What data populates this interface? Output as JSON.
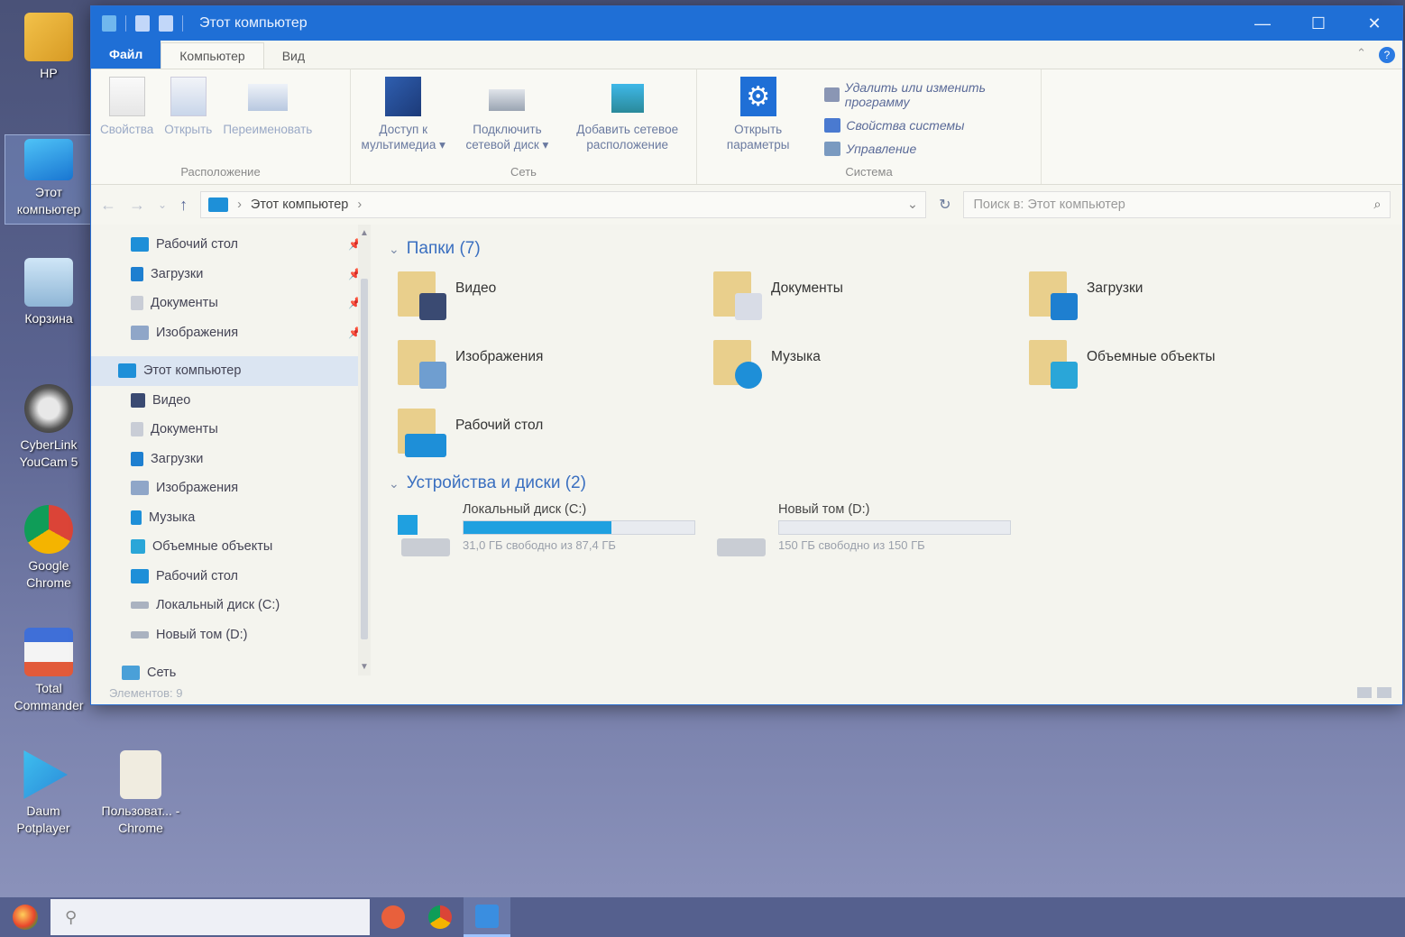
{
  "desktop": {
    "icons": [
      {
        "label": "HP"
      },
      {
        "label": "Этот компьютер"
      },
      {
        "label": "Корзина"
      },
      {
        "label": "CyberLink YouCam 5"
      },
      {
        "label": "Google Chrome"
      },
      {
        "label": "Total Commander"
      },
      {
        "label": "Daum Potplayer"
      },
      {
        "label": "Пользоват... - Chrome"
      }
    ]
  },
  "window": {
    "title": "Этот компьютер",
    "controls": {
      "minimize": "—",
      "maximize": "☐",
      "close": "✕"
    },
    "tabs": [
      {
        "label": "Файл"
      },
      {
        "label": "Компьютер"
      },
      {
        "label": "Вид"
      }
    ],
    "help": "?",
    "ribbon": {
      "location": {
        "label": "Расположение",
        "buttons": [
          {
            "label": "Свойства"
          },
          {
            "label": "Открыть"
          },
          {
            "label": "Переименовать"
          }
        ]
      },
      "network": {
        "label": "Сеть",
        "buttons": [
          {
            "label": "Доступ к мультимедиа ▾"
          },
          {
            "label": "Подключить сетевой диск ▾"
          },
          {
            "label": "Добавить сетевое расположение"
          }
        ]
      },
      "system": {
        "label": "Система",
        "open_settings": "Открыть параметры",
        "items": [
          {
            "label": "Удалить или изменить программу"
          },
          {
            "label": "Свойства системы"
          },
          {
            "label": "Управление"
          }
        ]
      }
    },
    "address": {
      "back": "←",
      "forward": "→",
      "recent": "⌄",
      "up": "↑",
      "path_sep": "›",
      "path": "Этот компьютер",
      "path_end": "›",
      "dropdown": "⌄",
      "refresh": "↻"
    },
    "search": {
      "placeholder": "Поиск в: Этот компьютер",
      "icon": "⌕"
    },
    "nav": {
      "quick": [
        {
          "label": "Рабочий стол",
          "color": "#1e8fd8"
        },
        {
          "label": "Загрузки",
          "color": "#1e7fd0"
        },
        {
          "label": "Документы",
          "color": "#c9cdd6"
        },
        {
          "label": "Изображения",
          "color": "#8fa6c8"
        }
      ],
      "pin": "📌",
      "this_pc": "Этот компьютер",
      "pc_items": [
        {
          "label": "Видео",
          "color": "#3a4a72"
        },
        {
          "label": "Документы",
          "color": "#c9cdd6"
        },
        {
          "label": "Загрузки",
          "color": "#1e7fd0"
        },
        {
          "label": "Изображения",
          "color": "#8fa6c8"
        },
        {
          "label": "Музыка",
          "color": "#1e8fd8"
        },
        {
          "label": "Объемные объекты",
          "color": "#2aa6d8"
        },
        {
          "label": "Рабочий стол",
          "color": "#1e8fd8"
        },
        {
          "label": "Локальный диск (C:)",
          "color": "#aab2c0"
        },
        {
          "label": "Новый том (D:)",
          "color": "#aab2c0"
        }
      ],
      "network": "Сеть"
    },
    "folders_header": "Папки (7)",
    "folders": [
      {
        "label": "Видео",
        "badge_color": "#3a4a72"
      },
      {
        "label": "Документы",
        "badge_color": "#d8dce6"
      },
      {
        "label": "Загрузки",
        "badge_color": "#1e7fd0"
      },
      {
        "label": "Изображения",
        "badge_color": "#6f9ed0"
      },
      {
        "label": "Музыка",
        "badge_color": "#1e8fd8"
      },
      {
        "label": "Объемные объекты",
        "badge_color": "#2aa6d8"
      },
      {
        "label": "Рабочий стол",
        "badge_color": "#1e8fd8"
      }
    ],
    "drives_header": "Устройства и диски (2)",
    "drives": [
      {
        "label": "Локальный диск (C:)",
        "free": "31,0 ГБ свободно из 87,4 ГБ",
        "used_percent": 64
      },
      {
        "label": "Новый том (D:)",
        "free": "150 ГБ свободно из 150 ГБ",
        "used_percent": 0
      }
    ],
    "status": "Элементов: 9"
  },
  "taskbar": {
    "search_icon": "⚲",
    "pinned": [
      {
        "name": "app-orange",
        "color": "#e8603c"
      },
      {
        "name": "chrome",
        "color": "#f2b63c"
      },
      {
        "name": "file-explorer",
        "color": "#3a8ee0"
      }
    ]
  },
  "colors": {
    "accent": "#1f6fd6",
    "drive_fill": "#1fa0e0",
    "section_header": "#3a6fc0"
  }
}
